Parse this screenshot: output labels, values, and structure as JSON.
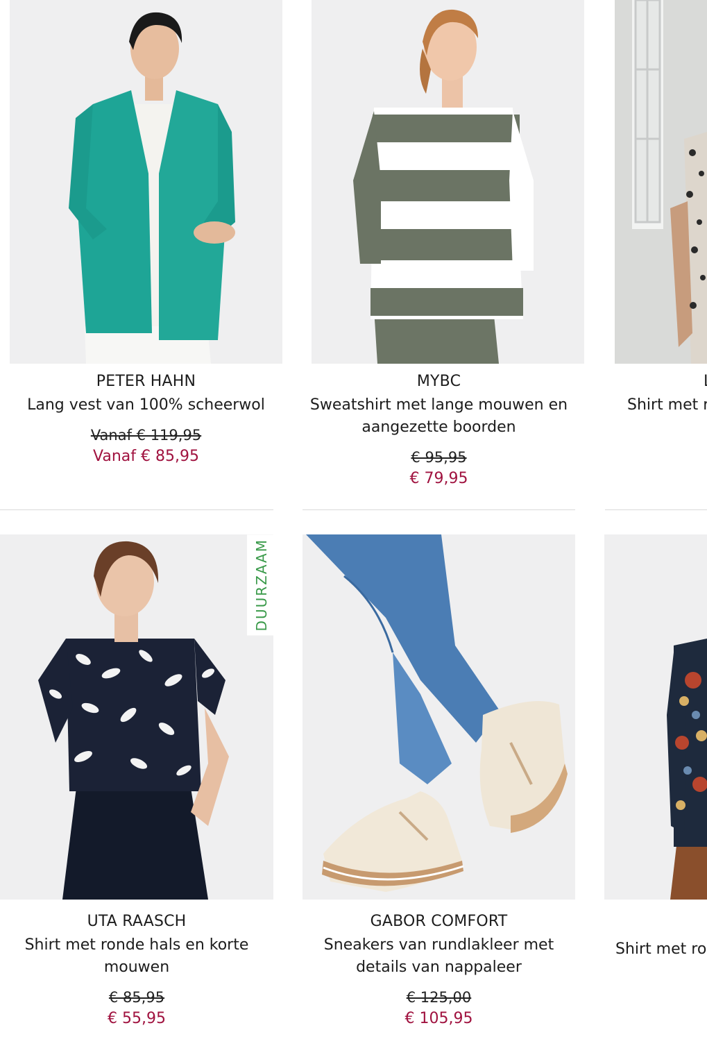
{
  "products": [
    {
      "brand": "PETER HAHN",
      "title": "Lang vest van 100% scheerwol",
      "old_price": "Vanaf € 119,95",
      "new_price": "Vanaf € 85,95"
    },
    {
      "brand": "MYBC",
      "title": "Sweatshirt met lange mouwen en aangezette boorden",
      "old_price": "€ 95,95",
      "new_price": "€ 79,95"
    },
    {
      "brand": "L",
      "title": "Shirt met r"
    },
    {
      "brand": "UTA RAASCH",
      "title": "Shirt met ronde hals en korte mouwen",
      "old_price": "€ 85,95",
      "new_price": "€ 55,95",
      "badge": "DUURZAAM"
    },
    {
      "brand": "GABOR COMFORT",
      "title": "Sneakers van rundlakleer met details van nappaleer",
      "old_price": "€ 125,00",
      "new_price": "€ 105,95"
    },
    {
      "title": "Shirt met ro"
    }
  ],
  "colors": {
    "sale_price": "#a0123f",
    "badge_text": "#3a9a4a",
    "image_bg": "#efeff0"
  }
}
